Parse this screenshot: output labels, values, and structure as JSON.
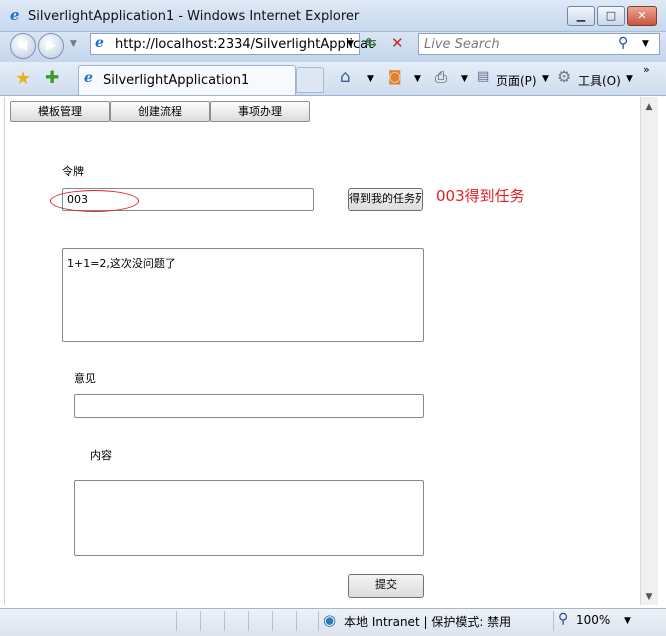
{
  "window": {
    "title": "SilverlightApplication1 - Windows Internet Explorer",
    "controls": {
      "minimize": "▁",
      "maximize": "□",
      "close": "✕"
    }
  },
  "nav": {
    "url": "http://localhost:2334/SilverlightApplicat",
    "search_placeholder": "Live Search"
  },
  "tabs": {
    "active_label": "SilverlightApplication1"
  },
  "command_bar": {
    "page_label": "页面(P)",
    "tools_label": "工具(O)"
  },
  "app": {
    "tabs": [
      "模板管理",
      "创建流程",
      "事项办理"
    ],
    "token_label": "令牌",
    "token_value": "003",
    "get_tasks_button": "得到我的任务列",
    "annotation": "003得到任务",
    "task_text": "1+1=2,这次没问题了",
    "opinion_label": "意见",
    "opinion_value": "",
    "content_label": "内容",
    "content_value": "",
    "submit_button": "提交"
  },
  "status": {
    "zone": "本地 Intranet | 保护模式: 禁用",
    "zoom": "100%"
  },
  "colors": {
    "annotation": "#e02020",
    "chrome": "#c7d8ee"
  }
}
